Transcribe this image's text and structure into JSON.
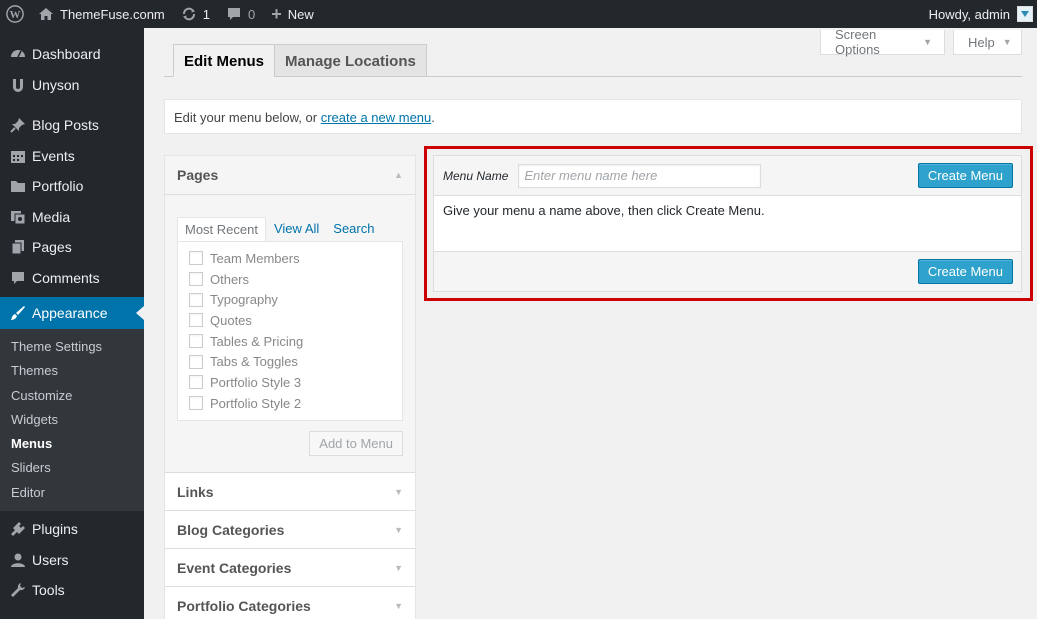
{
  "adminbar": {
    "site_name": "ThemeFuse.conm",
    "updates_count": "1",
    "comments_count": "0",
    "new_label": "New",
    "howdy": "Howdy, admin"
  },
  "sidebar": {
    "items_top": [
      {
        "label": "Dashboard",
        "icon": "dashboard-icon"
      },
      {
        "label": "Unyson",
        "icon": "unyson-icon"
      }
    ],
    "items_mid": [
      {
        "label": "Blog Posts",
        "icon": "pin-icon"
      },
      {
        "label": "Events",
        "icon": "calendar-icon"
      },
      {
        "label": "Portfolio",
        "icon": "folder-icon"
      },
      {
        "label": "Media",
        "icon": "media-icon"
      },
      {
        "label": "Pages",
        "icon": "pages-icon"
      },
      {
        "label": "Comments",
        "icon": "comment-icon"
      }
    ],
    "current": {
      "label": "Appearance",
      "icon": "brush-icon"
    },
    "submenu": [
      "Theme Settings",
      "Themes",
      "Customize",
      "Widgets",
      "Menus",
      "Sliders",
      "Editor"
    ],
    "items_bottom": [
      {
        "label": "Plugins",
        "icon": "plug-icon"
      },
      {
        "label": "Users",
        "icon": "user-icon"
      },
      {
        "label": "Tools",
        "icon": "wrench-icon"
      }
    ]
  },
  "header": {
    "screen_options": "Screen Options",
    "help": "Help",
    "tab_edit": "Edit Menus",
    "tab_manage": "Manage Locations"
  },
  "notice": {
    "prefix": "Edit your menu below, or ",
    "link": "create a new menu",
    "suffix": "."
  },
  "accordion": {
    "pages_title": "Pages",
    "sub_tabs": [
      "Most Recent",
      "View All",
      "Search"
    ],
    "pages": [
      "Team Members",
      "Others",
      "Typography",
      "Quotes",
      "Tables & Pricing",
      "Tabs & Toggles",
      "Portfolio Style 3",
      "Portfolio Style 2"
    ],
    "add_button": "Add to Menu",
    "sections": [
      "Links",
      "Blog Categories",
      "Event Categories",
      "Portfolio Categories"
    ]
  },
  "menu_editor": {
    "name_label": "Menu Name",
    "name_placeholder": "Enter menu name here",
    "name_value": "",
    "create_button": "Create Menu",
    "instructions": "Give your menu a name above, then click Create Menu."
  },
  "colors": {
    "admin_dark": "#23282d",
    "accent": "#0073aa",
    "primary_button": "#2ea2cc",
    "highlight": "#cc0000"
  }
}
